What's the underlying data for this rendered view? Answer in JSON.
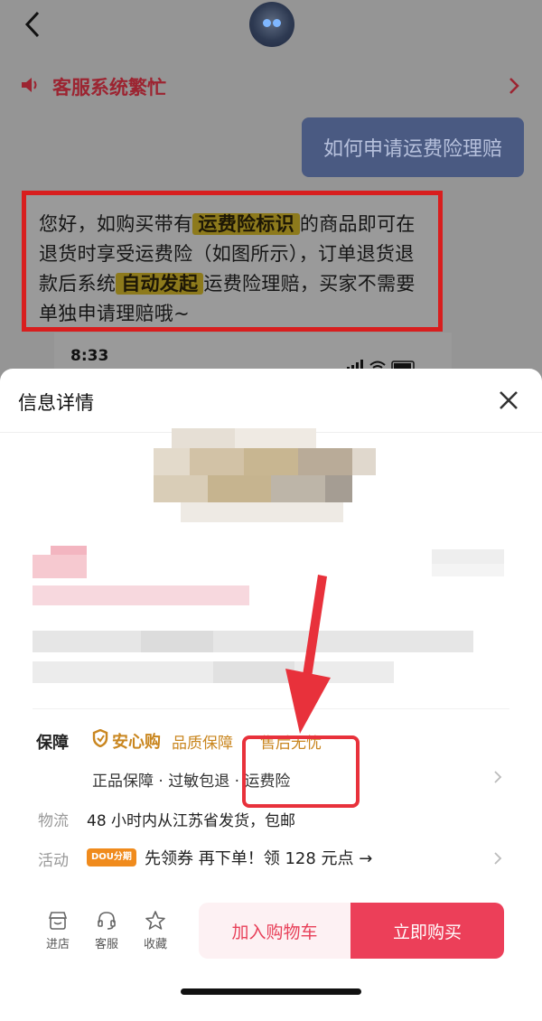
{
  "chat": {
    "notice": "客服系统繁忙",
    "user_question": "如何申请运费险理赔",
    "reply": {
      "p1": "您好，如购买带有",
      "h1": "运费险标识",
      "p2": "的商品即可在退货时享受运费险（如图所示），订单退货退款后系统",
      "h2": "自动发起",
      "p3": "运费险理赔，买家不需要单独申请理赔哦~"
    },
    "inner_time": "8:33"
  },
  "sheet": {
    "title": "信息详情",
    "guarantee_label": "保障",
    "anxin": "安心购",
    "quality": "品质保障",
    "aftersale": "售后无忧",
    "guarantee_items": "正品保障 · 过敏包退 · 运费险",
    "shipping_label": "物流",
    "shipping_text": "48 小时内从江苏省发货，包邮",
    "promo_label": "活动",
    "promo_badge": "DOU分期",
    "promo_text": "先领券 再下单！领 128 元点 →"
  },
  "actions": {
    "store": "进店",
    "service": "客服",
    "favorite": "收藏",
    "add_cart": "加入购物车",
    "buy_now": "立即购买"
  },
  "colors": {
    "accent_red": "#ec3f59",
    "highlight_box": "#e8313b",
    "gold": "#c9861f"
  }
}
